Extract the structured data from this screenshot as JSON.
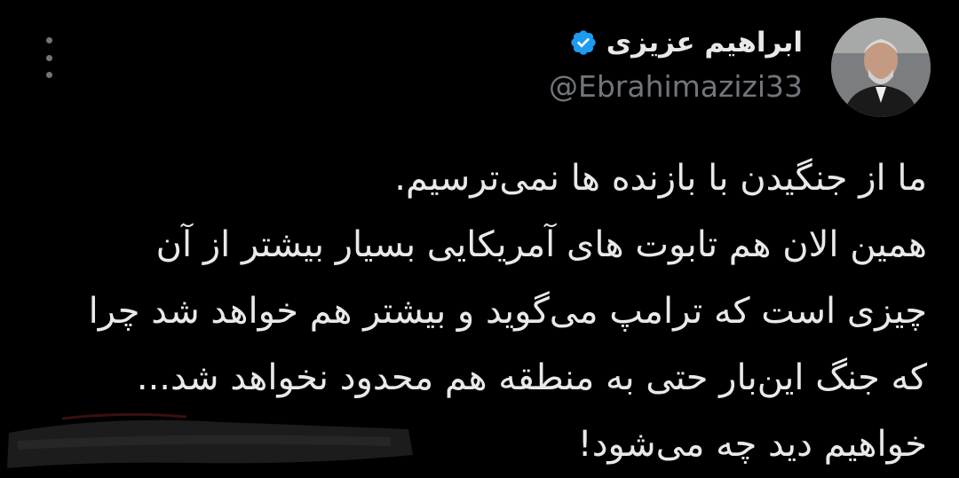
{
  "author": {
    "display_name": "ابراهیم عزیزی",
    "handle": "@Ebrahimazizi33",
    "verified": true,
    "verified_color": "#1d9bf0",
    "avatar_icon": "user-avatar"
  },
  "menu": {
    "icon": "more-vertical-icon"
  },
  "tweet": {
    "lines": [
      "ما از جنگیدن با بازنده ها نمی‌ترسیم.",
      "همین الان هم تابوت های آمریکایی بسیار بیشتر از آن",
      "چیزی است که ترامپ می‌گوید و بیشتر هم خواهد شد چرا",
      "که جنگ این‌بار حتی به منطقه هم محدود نخواهد شد...",
      "خواهیم دید چه می‌شود!"
    ]
  },
  "colors": {
    "background": "#000000",
    "text_primary": "#e7e9ea",
    "text_secondary": "#71767b"
  }
}
